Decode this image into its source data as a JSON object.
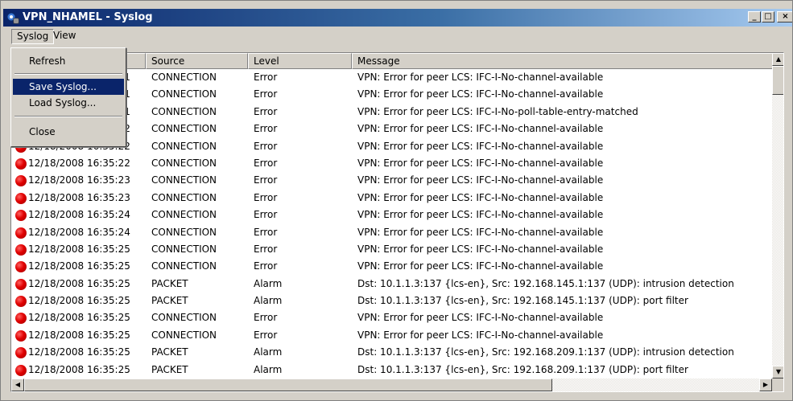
{
  "window": {
    "title": "VPN_NHAMEL - Syslog",
    "icon": "vpn-app-icon",
    "caption_buttons": {
      "minimize": "_",
      "maximize": "□",
      "close": "×"
    }
  },
  "menubar": {
    "items": [
      {
        "label": "Syslog"
      },
      {
        "label": "View"
      }
    ]
  },
  "syslog_menu": {
    "items": [
      {
        "label": "Refresh"
      },
      {
        "label": "Save Syslog..."
      },
      {
        "label": "Load Syslog..."
      },
      {
        "label": "Close"
      }
    ],
    "highlighted": "Save Syslog..."
  },
  "columns": {
    "source": "Source",
    "level": "Level",
    "message": "Message"
  },
  "rows": [
    {
      "date": "12/18/2008 16:35:21",
      "source": "CONNECTION",
      "level": "Error",
      "message": "VPN: Error for peer LCS: IFC-I-No-channel-available"
    },
    {
      "date": "12/18/2008 16:35:21",
      "source": "CONNECTION",
      "level": "Error",
      "message": "VPN: Error for peer LCS: IFC-I-No-channel-available"
    },
    {
      "date": "12/18/2008 16:35:21",
      "source": "CONNECTION",
      "level": "Error",
      "message": "VPN: Error for peer LCS: IFC-I-No-poll-table-entry-matched"
    },
    {
      "date": "12/18/2008 16:35:22",
      "source": "CONNECTION",
      "level": "Error",
      "message": "VPN: Error for peer LCS: IFC-I-No-channel-available"
    },
    {
      "date": "12/18/2008 16:35:22",
      "source": "CONNECTION",
      "level": "Error",
      "message": "VPN: Error for peer LCS: IFC-I-No-channel-available"
    },
    {
      "date": "12/18/2008 16:35:22",
      "source": "CONNECTION",
      "level": "Error",
      "message": "VPN: Error for peer LCS: IFC-I-No-channel-available"
    },
    {
      "date": "12/18/2008 16:35:23",
      "source": "CONNECTION",
      "level": "Error",
      "message": "VPN: Error for peer LCS: IFC-I-No-channel-available"
    },
    {
      "date": "12/18/2008 16:35:23",
      "source": "CONNECTION",
      "level": "Error",
      "message": "VPN: Error for peer LCS: IFC-I-No-channel-available"
    },
    {
      "date": "12/18/2008 16:35:24",
      "source": "CONNECTION",
      "level": "Error",
      "message": "VPN: Error for peer LCS: IFC-I-No-channel-available"
    },
    {
      "date": "12/18/2008 16:35:24",
      "source": "CONNECTION",
      "level": "Error",
      "message": "VPN: Error for peer LCS: IFC-I-No-channel-available"
    },
    {
      "date": "12/18/2008 16:35:25",
      "source": "CONNECTION",
      "level": "Error",
      "message": "VPN: Error for peer LCS: IFC-I-No-channel-available"
    },
    {
      "date": "12/18/2008 16:35:25",
      "source": "CONNECTION",
      "level": "Error",
      "message": "VPN: Error for peer LCS: IFC-I-No-channel-available"
    },
    {
      "date": "12/18/2008 16:35:25",
      "source": "PACKET",
      "level": "Alarm",
      "message": "Dst: 10.1.1.3:137 {lcs-en}, Src: 192.168.145.1:137 (UDP): intrusion detection"
    },
    {
      "date": "12/18/2008 16:35:25",
      "source": "PACKET",
      "level": "Alarm",
      "message": "Dst: 10.1.1.3:137 {lcs-en}, Src: 192.168.145.1:137 (UDP): port filter"
    },
    {
      "date": "12/18/2008 16:35:25",
      "source": "CONNECTION",
      "level": "Error",
      "message": "VPN: Error for peer LCS: IFC-I-No-channel-available"
    },
    {
      "date": "12/18/2008 16:35:25",
      "source": "CONNECTION",
      "level": "Error",
      "message": "VPN: Error for peer LCS: IFC-I-No-channel-available"
    },
    {
      "date": "12/18/2008 16:35:25",
      "source": "PACKET",
      "level": "Alarm",
      "message": "Dst: 10.1.1.3:137 {lcs-en}, Src: 192.168.209.1:137 (UDP): intrusion detection"
    },
    {
      "date": "12/18/2008 16:35:25",
      "source": "PACKET",
      "level": "Alarm",
      "message": "Dst: 10.1.1.3:137 {lcs-en}, Src: 192.168.209.1:137 (UDP): port filter"
    }
  ],
  "row_icon": "red-circle-icon",
  "colors": {
    "titlebar_start": "#0a246a",
    "titlebar_end": "#a6caf0",
    "menu_highlight": "#0a246a",
    "error_icon": "#e00000",
    "chrome": "#d4d0c8"
  }
}
